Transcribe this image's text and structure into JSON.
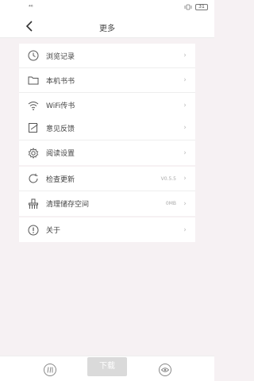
{
  "status": {
    "signal": "⁴⁶",
    "battery": "31"
  },
  "header": {
    "title": "更多"
  },
  "groups": [
    {
      "items": [
        {
          "label": "浏览记录",
          "icon": "clock-icon"
        },
        {
          "label": "本机书书",
          "icon": "folder-icon"
        },
        {
          "label": "WiFi传书",
          "icon": "wifi-icon"
        }
      ]
    },
    {
      "items": [
        {
          "label": "意见反馈",
          "icon": "feedback-icon"
        },
        {
          "label": "阅读设置",
          "icon": "gear-icon"
        }
      ]
    },
    {
      "items": [
        {
          "label": "检查更新",
          "icon": "refresh-icon",
          "value": "V0.5.5"
        },
        {
          "label": "清理储存空间",
          "icon": "broom-icon",
          "value": "0MB"
        }
      ]
    },
    {
      "items": [
        {
          "label": "关于",
          "icon": "info-icon"
        }
      ]
    }
  ],
  "bottom": {
    "download_label": "下载"
  },
  "colors": {
    "background": "#f6f1f3",
    "card": "#ffffff",
    "text": "#444444"
  }
}
